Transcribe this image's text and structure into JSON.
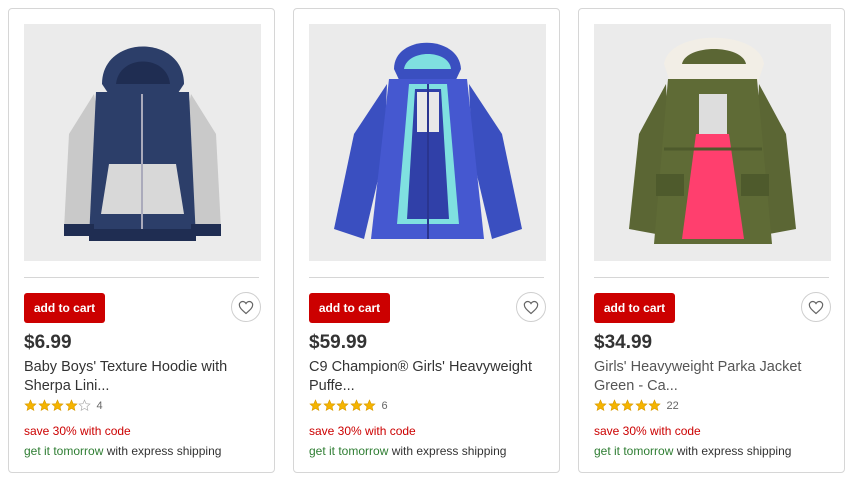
{
  "products": [
    {
      "image_alt": "hoodie image",
      "button": "add to cart",
      "price": "$6.99",
      "title_line1": "Baby Boys' Texture Hoodie with",
      "title_line2": "Sherpa Lini...",
      "rating": 4,
      "review_count": "4",
      "promo": "save 30% with code",
      "ship_highlight": "get it tomorrow",
      "ship_rest": " with express shipping",
      "colors": {
        "main": "#2c3e69",
        "accent": "#c9c9c9"
      }
    },
    {
      "image_alt": "jacket image",
      "button": "add to cart",
      "price": "$59.99",
      "title_line1": "C9 Champion® Girls' Heavyweight",
      "title_line2": "Puffe...",
      "rating": 5,
      "review_count": "6",
      "promo": "save 30% with code",
      "ship_highlight": "get it tomorrow",
      "ship_rest": " with express shipping",
      "colors": {
        "main": "#3a4fc0",
        "accent": "#7fe0e0"
      }
    },
    {
      "image_alt": "parka image",
      "button": "add to cart",
      "price": "$34.99",
      "title_line1": "Girls' Heavyweight Parka Jacket",
      "title_line2": "Green - Ca...",
      "rating": 5,
      "review_count": "22",
      "promo": "save 30% with code",
      "ship_highlight": "get it tomorrow",
      "ship_rest": " with express shipping",
      "colors": {
        "main": "#5b6634",
        "accent": "#ff3f6e"
      }
    }
  ],
  "colors": {
    "brand_red": "#cc0000",
    "star": "#f5b400",
    "ship_green": "#2e7d32"
  }
}
